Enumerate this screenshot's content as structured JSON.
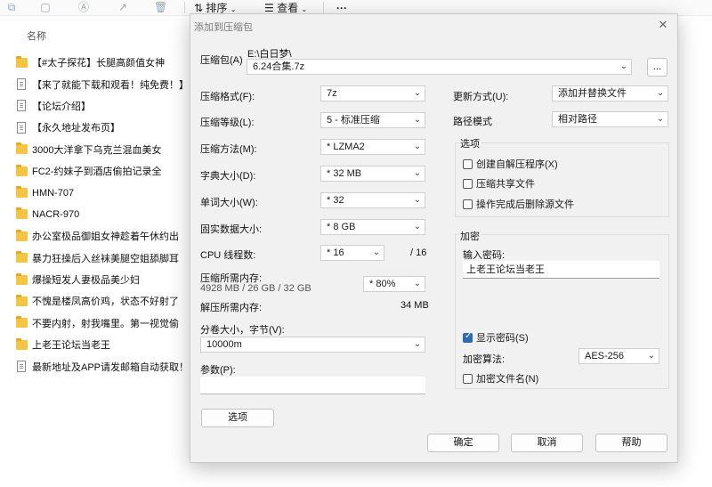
{
  "explorer": {
    "toolbar": {
      "sort_label": "排序",
      "view_label": "查看",
      "more_label": "···"
    },
    "column_header": "名称",
    "files": [
      {
        "type": "folder",
        "name": "【#太子探花】长腿高颜值女神"
      },
      {
        "type": "doc",
        "name": "【来了就能下载和观看！纯免费！】"
      },
      {
        "type": "doc",
        "name": "【论坛介绍】"
      },
      {
        "type": "doc",
        "name": "【永久地址发布页】"
      },
      {
        "type": "folder",
        "name": "3000大洋拿下乌克兰混血美女"
      },
      {
        "type": "folder",
        "name": "FC2-约妹子到酒店偷拍记录全"
      },
      {
        "type": "folder",
        "name": "HMN-707"
      },
      {
        "type": "folder",
        "name": "NACR-970"
      },
      {
        "type": "folder",
        "name": "办公室极品御姐女神趁着午休约出"
      },
      {
        "type": "folder",
        "name": "暴力狂操后入丝袜美腿空姐舔脚耳"
      },
      {
        "type": "folder",
        "name": "爆操短发人妻极品美少妇"
      },
      {
        "type": "folder",
        "name": "不愧是楼凤高价鸡，状态不好射了"
      },
      {
        "type": "folder",
        "name": "不要内射，射我嘴里。第一视觉偷"
      },
      {
        "type": "folder",
        "name": "上老王论坛当老王"
      },
      {
        "type": "doc",
        "name": "最新地址及APP请发邮箱自动获取！！"
      }
    ]
  },
  "dialog": {
    "title": "添加到压缩包",
    "close": "✕",
    "archive_label": "压缩包(A)",
    "archive_path": "E:\\白日梦\\",
    "archive_name": "6.24合集.7z",
    "browse_label": "...",
    "left": {
      "format_label": "压缩格式(F):",
      "format_value": "7z",
      "level_label": "压缩等级(L):",
      "level_value": "5 - 标准压缩",
      "method_label": "压缩方法(M):",
      "method_value": "* LZMA2",
      "dict_label": "字典大小(D):",
      "dict_value": "* 32 MB",
      "word_label": "单词大小(W):",
      "word_value": "* 32",
      "solid_label": "固实数据大小:",
      "solid_value": "* 8 GB",
      "cpu_label": "CPU 线程数:",
      "cpu_value": "* 16",
      "cpu_total": "/ 16",
      "mem_label": "压缩所需内存:",
      "mem_detail": "4928 MB / 26 GB / 32 GB",
      "mem_value": "* 80%",
      "decomp_label": "解压所需内存:",
      "decomp_value": "34 MB",
      "split_label": "分卷大小，字节(V):",
      "split_value": "10000m",
      "params_label": "参数(P):",
      "params_value": "",
      "options_button": "选项"
    },
    "right": {
      "update_label": "更新方式(U):",
      "update_value": "添加并替换文件",
      "path_label": "路径模式",
      "path_value": "相对路径",
      "options_group": "选项",
      "opt_sfx": "创建自解压程序(X)",
      "opt_shared": "压缩共享文件",
      "opt_delete": "操作完成后删除源文件",
      "encrypt_group": "加密",
      "pwd_label": "输入密码:",
      "pwd_value": "上老王论坛当老王",
      "show_pwd": "显示密码(S)",
      "algo_label": "加密算法:",
      "algo_value": "AES-256",
      "encrypt_names": "加密文件名(N)"
    },
    "buttons": {
      "ok": "确定",
      "cancel": "取消",
      "help": "帮助"
    }
  }
}
